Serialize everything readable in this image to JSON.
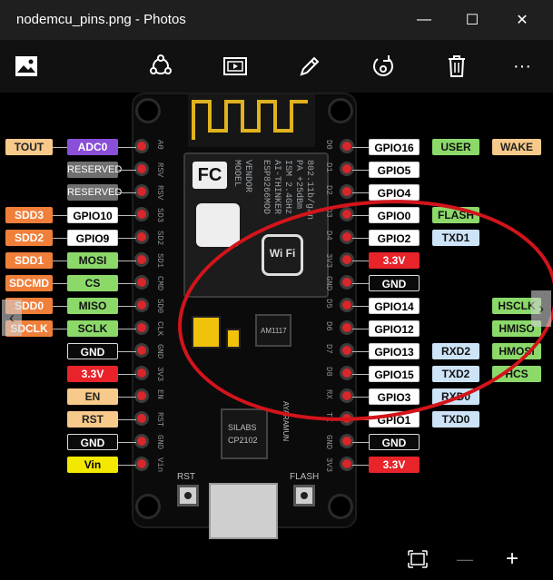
{
  "window": {
    "title": "nodemcu_pins.png - Photos",
    "minimize_glyph": "—",
    "maximize_glyph": "☐",
    "close_glyph": "✕"
  },
  "toolbar": {
    "items": [
      "image-icon",
      "share-icon",
      "slideshow-icon",
      "edit-icon",
      "rotate-icon",
      "delete-icon",
      "more-icon"
    ],
    "more_glyph": "···"
  },
  "bottom": {
    "minus_glyph": "—",
    "plus_glyph": "+"
  },
  "left_labels": [
    {
      "outer": "TOUT",
      "inner": "ADC0"
    },
    {
      "outer": "",
      "inner": "RESERVED"
    },
    {
      "outer": "",
      "inner": "RESERVED"
    },
    {
      "outer": "SDD3",
      "inner": "GPIO10"
    },
    {
      "outer": "SDD2",
      "inner": "GPIO9"
    },
    {
      "outer": "SDD1",
      "inner": "MOSI"
    },
    {
      "outer": "SDCMD",
      "inner": "CS"
    },
    {
      "outer": "SDD0",
      "inner": "MISO"
    },
    {
      "outer": "SDCLK",
      "inner": "SCLK"
    },
    {
      "outer": "",
      "inner": "GND"
    },
    {
      "outer": "",
      "inner": "3.3V"
    },
    {
      "outer": "",
      "inner": "EN"
    },
    {
      "outer": "",
      "inner": "RST"
    },
    {
      "outer": "",
      "inner": "GND"
    },
    {
      "outer": "",
      "inner": "Vin"
    }
  ],
  "right_labels": [
    {
      "inner": "GPIO16",
      "mid": "USER",
      "outer": "WAKE"
    },
    {
      "inner": "GPIO5",
      "mid": "",
      "outer": ""
    },
    {
      "inner": "GPIO4",
      "mid": "",
      "outer": ""
    },
    {
      "inner": "GPIO0",
      "mid": "FLASH",
      "outer": ""
    },
    {
      "inner": "GPIO2",
      "mid": "TXD1",
      "outer": ""
    },
    {
      "inner": "3.3V",
      "mid": "",
      "outer": ""
    },
    {
      "inner": "GND",
      "mid": "",
      "outer": ""
    },
    {
      "inner": "GPIO14",
      "mid": "",
      "outer": "HSCLK"
    },
    {
      "inner": "GPIO12",
      "mid": "",
      "outer": "HMISO"
    },
    {
      "inner": "GPIO13",
      "mid": "RXD2",
      "outer": "HMOSI"
    },
    {
      "inner": "GPIO15",
      "mid": "TXD2",
      "outer": "HCS"
    },
    {
      "inner": "GPIO3",
      "mid": "RXD0",
      "outer": ""
    },
    {
      "inner": "GPIO1",
      "mid": "TXD0",
      "outer": ""
    },
    {
      "inner": "GND",
      "mid": "",
      "outer": ""
    },
    {
      "inner": "3.3V",
      "mid": "",
      "outer": ""
    }
  ],
  "board_left_pins": [
    "A0",
    "RSV",
    "RSV",
    "SD3",
    "SD2",
    "SD1",
    "CMD",
    "SD0",
    "CLK",
    "GND",
    "3V3",
    "EN",
    "RST",
    "GND",
    "Vin"
  ],
  "board_right_pins": [
    "D0",
    "D1",
    "D2",
    "D3",
    "D4",
    "3V3",
    "GND",
    "D5",
    "D6",
    "D7",
    "D8",
    "RX",
    "TX",
    "GND",
    "3V3"
  ],
  "module_text": [
    "MODEL",
    "VENDOR",
    "ESP8266MOD",
    "AI-THINKER",
    "ISM 2.4GHz",
    "PA +25dBm",
    "802.11b/g/n"
  ],
  "wifi_logo_text": "Wi Fi",
  "fcc_text": "FC",
  "regulator_text": "AM1117",
  "chip_text": [
    "SILABS",
    "CP2102"
  ],
  "button_labels": {
    "rst": "RST",
    "flash": "FLASH"
  },
  "board_slogan": "AYARAMUN"
}
